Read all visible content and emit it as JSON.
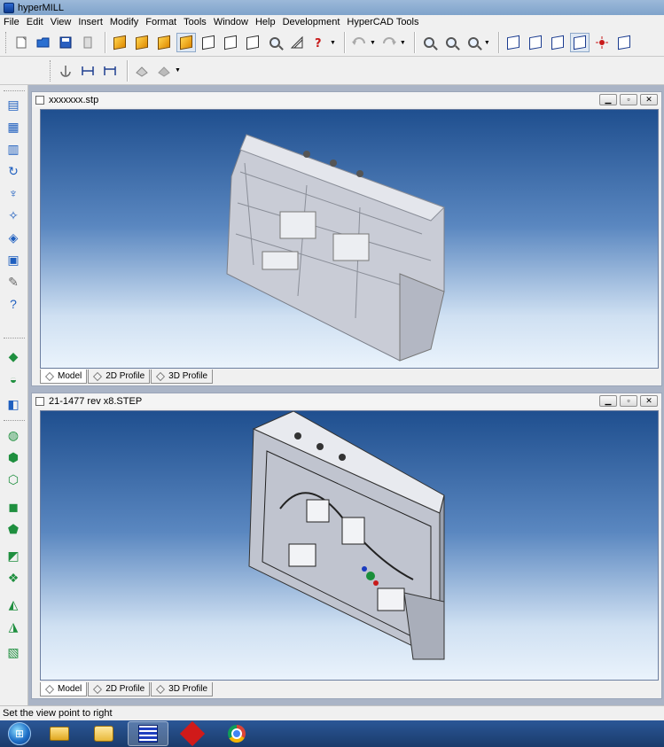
{
  "window": {
    "title": "hyperMILL"
  },
  "menu": {
    "items": [
      "File",
      "Edit",
      "View",
      "Insert",
      "Modify",
      "Format",
      "Tools",
      "Window",
      "Help",
      "Development",
      "HyperCAD Tools"
    ]
  },
  "docs": [
    {
      "title": "xxxxxxx.stp",
      "tabs": [
        "Model",
        "2D Profile",
        "3D Profile"
      ],
      "active_tab": "Model"
    },
    {
      "title": "21-1477 rev x8.STEP",
      "tabs": [
        "Model",
        "2D Profile",
        "3D Profile"
      ],
      "active_tab": "Model"
    }
  ],
  "status": {
    "text": "Set the view point to right"
  },
  "icons": {
    "toolbar1": [
      "new-icon",
      "open-icon",
      "save-icon",
      "page-icon",
      "shaded-cube-icon",
      "shaded-cube-icon",
      "shaded-cube-icon",
      "shaded-cube-icon",
      "wireframe-cube-icon",
      "wireframe-cube-icon",
      "wireframe-cube-icon",
      "zoom-icon",
      "measure-icon",
      "help-icon",
      "undo-icon",
      "redo-icon",
      "zoom-in-icon",
      "zoom-out-icon",
      "zoom-fit-icon",
      "view-cube-icon"
    ],
    "taskbar": [
      "start-orb-icon",
      "explorer-folder-icon",
      "outlook-mail-icon",
      "hypermill-icon",
      "hypercad-icon",
      "chrome-icon"
    ]
  },
  "colors": {
    "viewport_top": "#1f4f8f",
    "viewport_bottom": "#eaf3fc",
    "accent_orange": "#e08a00",
    "taskbar": "#2b5797"
  }
}
